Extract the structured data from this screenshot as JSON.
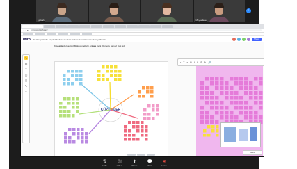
{
  "meeting": {
    "participants": [
      {
        "name": "gulsah",
        "hair": "#3b2a20",
        "shirt": "#5a6b7a"
      },
      {
        "name": "",
        "hair": "#2a1d16",
        "shirt": "#7b5e4f"
      },
      {
        "name": "",
        "hair": "#4a3020",
        "shirt": "#5b6d56"
      },
      {
        "name": "Meyve Eker",
        "hair": "#2b1f18",
        "shirt": "#6c4a5e"
      }
    ]
  },
  "browser": {
    "url": "miro.com/app/board/",
    "tab_count": 12
  },
  "miro": {
    "logo": "miro",
    "board_title": "Pro   Kavşaklarda Kayıtsız Mukavemetlerin Ankara Kent Otomotiv Sanayi Test Ed",
    "share_label": "Share",
    "frame_title": "Kavşaklarda Kayıtsız Mukavemetlerin Ankara Kent Otomotiv Sanayi Test Ed",
    "center_label": "ÇÖZÜMLER",
    "center_sub": "",
    "zoom_level": "100%",
    "tools": [
      "↖",
      "▭",
      "T",
      "▢",
      "◻",
      "✎",
      "A",
      "⋯"
    ],
    "float_tools": [
      "•",
      "T",
      "≡",
      "B",
      "I",
      "U",
      "S",
      "A",
      "🔗"
    ],
    "colors": {
      "accent": "#4262ff",
      "brand": "#ffd02f",
      "pink": "#f0b7ee"
    }
  },
  "zoom_controls": [
    {
      "label": "Audio",
      "icon": "🎙"
    },
    {
      "label": "Video",
      "icon": "🎥"
    },
    {
      "label": "Share",
      "icon": "⬆"
    },
    {
      "label": "Chat",
      "icon": "💬"
    },
    {
      "label": "Leave",
      "icon": "✖"
    }
  ]
}
